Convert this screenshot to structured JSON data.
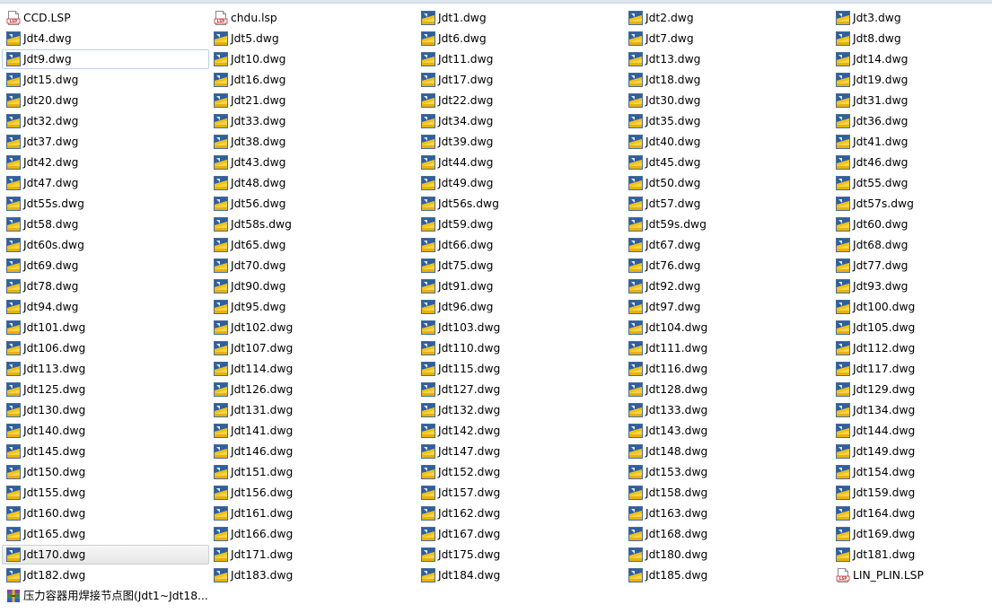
{
  "files": [
    {
      "name": "CCD.LSP",
      "icon": "lsp-file-icon"
    },
    {
      "name": "chdu.lsp",
      "icon": "lsp-file-icon"
    },
    {
      "name": "Jdt1.dwg",
      "icon": "dwg-file-icon"
    },
    {
      "name": "Jdt2.dwg",
      "icon": "dwg-file-icon"
    },
    {
      "name": "Jdt3.dwg",
      "icon": "dwg-file-icon"
    },
    {
      "name": "Jdt4.dwg",
      "icon": "dwg-file-icon"
    },
    {
      "name": "Jdt5.dwg",
      "icon": "dwg-file-icon"
    },
    {
      "name": "Jdt6.dwg",
      "icon": "dwg-file-icon"
    },
    {
      "name": "Jdt7.dwg",
      "icon": "dwg-file-icon"
    },
    {
      "name": "Jdt8.dwg",
      "icon": "dwg-file-icon"
    },
    {
      "name": "Jdt9.dwg",
      "icon": "dwg-file-icon",
      "state": "focused"
    },
    {
      "name": "Jdt10.dwg",
      "icon": "dwg-file-icon"
    },
    {
      "name": "Jdt11.dwg",
      "icon": "dwg-file-icon"
    },
    {
      "name": "Jdt13.dwg",
      "icon": "dwg-file-icon"
    },
    {
      "name": "Jdt14.dwg",
      "icon": "dwg-file-icon"
    },
    {
      "name": "Jdt15.dwg",
      "icon": "dwg-file-icon"
    },
    {
      "name": "Jdt16.dwg",
      "icon": "dwg-file-icon"
    },
    {
      "name": "Jdt17.dwg",
      "icon": "dwg-file-icon"
    },
    {
      "name": "Jdt18.dwg",
      "icon": "dwg-file-icon"
    },
    {
      "name": "Jdt19.dwg",
      "icon": "dwg-file-icon"
    },
    {
      "name": "Jdt20.dwg",
      "icon": "dwg-file-icon"
    },
    {
      "name": "Jdt21.dwg",
      "icon": "dwg-file-icon"
    },
    {
      "name": "Jdt22.dwg",
      "icon": "dwg-file-icon"
    },
    {
      "name": "Jdt30.dwg",
      "icon": "dwg-file-icon"
    },
    {
      "name": "Jdt31.dwg",
      "icon": "dwg-file-icon"
    },
    {
      "name": "Jdt32.dwg",
      "icon": "dwg-file-icon"
    },
    {
      "name": "Jdt33.dwg",
      "icon": "dwg-file-icon"
    },
    {
      "name": "Jdt34.dwg",
      "icon": "dwg-file-icon"
    },
    {
      "name": "Jdt35.dwg",
      "icon": "dwg-file-icon"
    },
    {
      "name": "Jdt36.dwg",
      "icon": "dwg-file-icon"
    },
    {
      "name": "Jdt37.dwg",
      "icon": "dwg-file-icon"
    },
    {
      "name": "Jdt38.dwg",
      "icon": "dwg-file-icon"
    },
    {
      "name": "Jdt39.dwg",
      "icon": "dwg-file-icon"
    },
    {
      "name": "Jdt40.dwg",
      "icon": "dwg-file-icon"
    },
    {
      "name": "Jdt41.dwg",
      "icon": "dwg-file-icon"
    },
    {
      "name": "Jdt42.dwg",
      "icon": "dwg-file-icon"
    },
    {
      "name": "Jdt43.dwg",
      "icon": "dwg-file-icon"
    },
    {
      "name": "Jdt44.dwg",
      "icon": "dwg-file-icon"
    },
    {
      "name": "Jdt45.dwg",
      "icon": "dwg-file-icon"
    },
    {
      "name": "Jdt46.dwg",
      "icon": "dwg-file-icon"
    },
    {
      "name": "Jdt47.dwg",
      "icon": "dwg-file-icon"
    },
    {
      "name": "Jdt48.dwg",
      "icon": "dwg-file-icon"
    },
    {
      "name": "Jdt49.dwg",
      "icon": "dwg-file-icon"
    },
    {
      "name": "Jdt50.dwg",
      "icon": "dwg-file-icon"
    },
    {
      "name": "Jdt55.dwg",
      "icon": "dwg-file-icon"
    },
    {
      "name": "Jdt55s.dwg",
      "icon": "dwg-file-icon"
    },
    {
      "name": "Jdt56.dwg",
      "icon": "dwg-file-icon"
    },
    {
      "name": "Jdt56s.dwg",
      "icon": "dwg-file-icon"
    },
    {
      "name": "Jdt57.dwg",
      "icon": "dwg-file-icon"
    },
    {
      "name": "Jdt57s.dwg",
      "icon": "dwg-file-icon"
    },
    {
      "name": "Jdt58.dwg",
      "icon": "dwg-file-icon"
    },
    {
      "name": "Jdt58s.dwg",
      "icon": "dwg-file-icon"
    },
    {
      "name": "Jdt59.dwg",
      "icon": "dwg-file-icon"
    },
    {
      "name": "Jdt59s.dwg",
      "icon": "dwg-file-icon"
    },
    {
      "name": "Jdt60.dwg",
      "icon": "dwg-file-icon"
    },
    {
      "name": "Jdt60s.dwg",
      "icon": "dwg-file-icon"
    },
    {
      "name": "Jdt65.dwg",
      "icon": "dwg-file-icon"
    },
    {
      "name": "Jdt66.dwg",
      "icon": "dwg-file-icon"
    },
    {
      "name": "Jdt67.dwg",
      "icon": "dwg-file-icon"
    },
    {
      "name": "Jdt68.dwg",
      "icon": "dwg-file-icon"
    },
    {
      "name": "Jdt69.dwg",
      "icon": "dwg-file-icon"
    },
    {
      "name": "Jdt70.dwg",
      "icon": "dwg-file-icon"
    },
    {
      "name": "Jdt75.dwg",
      "icon": "dwg-file-icon"
    },
    {
      "name": "Jdt76.dwg",
      "icon": "dwg-file-icon"
    },
    {
      "name": "Jdt77.dwg",
      "icon": "dwg-file-icon"
    },
    {
      "name": "Jdt78.dwg",
      "icon": "dwg-file-icon"
    },
    {
      "name": "Jdt90.dwg",
      "icon": "dwg-file-icon"
    },
    {
      "name": "Jdt91.dwg",
      "icon": "dwg-file-icon"
    },
    {
      "name": "Jdt92.dwg",
      "icon": "dwg-file-icon"
    },
    {
      "name": "Jdt93.dwg",
      "icon": "dwg-file-icon"
    },
    {
      "name": "Jdt94.dwg",
      "icon": "dwg-file-icon"
    },
    {
      "name": "Jdt95.dwg",
      "icon": "dwg-file-icon"
    },
    {
      "name": "Jdt96.dwg",
      "icon": "dwg-file-icon"
    },
    {
      "name": "Jdt97.dwg",
      "icon": "dwg-file-icon"
    },
    {
      "name": "Jdt100.dwg",
      "icon": "dwg-file-icon"
    },
    {
      "name": "Jdt101.dwg",
      "icon": "dwg-file-icon"
    },
    {
      "name": "Jdt102.dwg",
      "icon": "dwg-file-icon"
    },
    {
      "name": "Jdt103.dwg",
      "icon": "dwg-file-icon"
    },
    {
      "name": "Jdt104.dwg",
      "icon": "dwg-file-icon"
    },
    {
      "name": "Jdt105.dwg",
      "icon": "dwg-file-icon"
    },
    {
      "name": "Jdt106.dwg",
      "icon": "dwg-file-icon"
    },
    {
      "name": "Jdt107.dwg",
      "icon": "dwg-file-icon"
    },
    {
      "name": "Jdt110.dwg",
      "icon": "dwg-file-icon"
    },
    {
      "name": "Jdt111.dwg",
      "icon": "dwg-file-icon"
    },
    {
      "name": "Jdt112.dwg",
      "icon": "dwg-file-icon"
    },
    {
      "name": "Jdt113.dwg",
      "icon": "dwg-file-icon"
    },
    {
      "name": "Jdt114.dwg",
      "icon": "dwg-file-icon"
    },
    {
      "name": "Jdt115.dwg",
      "icon": "dwg-file-icon"
    },
    {
      "name": "Jdt116.dwg",
      "icon": "dwg-file-icon"
    },
    {
      "name": "Jdt117.dwg",
      "icon": "dwg-file-icon"
    },
    {
      "name": "Jdt125.dwg",
      "icon": "dwg-file-icon"
    },
    {
      "name": "Jdt126.dwg",
      "icon": "dwg-file-icon"
    },
    {
      "name": "Jdt127.dwg",
      "icon": "dwg-file-icon"
    },
    {
      "name": "Jdt128.dwg",
      "icon": "dwg-file-icon"
    },
    {
      "name": "Jdt129.dwg",
      "icon": "dwg-file-icon"
    },
    {
      "name": "Jdt130.dwg",
      "icon": "dwg-file-icon"
    },
    {
      "name": "Jdt131.dwg",
      "icon": "dwg-file-icon"
    },
    {
      "name": "Jdt132.dwg",
      "icon": "dwg-file-icon"
    },
    {
      "name": "Jdt133.dwg",
      "icon": "dwg-file-icon"
    },
    {
      "name": "Jdt134.dwg",
      "icon": "dwg-file-icon"
    },
    {
      "name": "Jdt140.dwg",
      "icon": "dwg-file-icon"
    },
    {
      "name": "Jdt141.dwg",
      "icon": "dwg-file-icon"
    },
    {
      "name": "Jdt142.dwg",
      "icon": "dwg-file-icon"
    },
    {
      "name": "Jdt143.dwg",
      "icon": "dwg-file-icon"
    },
    {
      "name": "Jdt144.dwg",
      "icon": "dwg-file-icon"
    },
    {
      "name": "Jdt145.dwg",
      "icon": "dwg-file-icon"
    },
    {
      "name": "Jdt146.dwg",
      "icon": "dwg-file-icon"
    },
    {
      "name": "Jdt147.dwg",
      "icon": "dwg-file-icon"
    },
    {
      "name": "Jdt148.dwg",
      "icon": "dwg-file-icon"
    },
    {
      "name": "Jdt149.dwg",
      "icon": "dwg-file-icon"
    },
    {
      "name": "Jdt150.dwg",
      "icon": "dwg-file-icon"
    },
    {
      "name": "Jdt151.dwg",
      "icon": "dwg-file-icon"
    },
    {
      "name": "Jdt152.dwg",
      "icon": "dwg-file-icon"
    },
    {
      "name": "Jdt153.dwg",
      "icon": "dwg-file-icon"
    },
    {
      "name": "Jdt154.dwg",
      "icon": "dwg-file-icon"
    },
    {
      "name": "Jdt155.dwg",
      "icon": "dwg-file-icon"
    },
    {
      "name": "Jdt156.dwg",
      "icon": "dwg-file-icon"
    },
    {
      "name": "Jdt157.dwg",
      "icon": "dwg-file-icon"
    },
    {
      "name": "Jdt158.dwg",
      "icon": "dwg-file-icon"
    },
    {
      "name": "Jdt159.dwg",
      "icon": "dwg-file-icon"
    },
    {
      "name": "Jdt160.dwg",
      "icon": "dwg-file-icon"
    },
    {
      "name": "Jdt161.dwg",
      "icon": "dwg-file-icon"
    },
    {
      "name": "Jdt162.dwg",
      "icon": "dwg-file-icon"
    },
    {
      "name": "Jdt163.dwg",
      "icon": "dwg-file-icon"
    },
    {
      "name": "Jdt164.dwg",
      "icon": "dwg-file-icon"
    },
    {
      "name": "Jdt165.dwg",
      "icon": "dwg-file-icon"
    },
    {
      "name": "Jdt166.dwg",
      "icon": "dwg-file-icon"
    },
    {
      "name": "Jdt167.dwg",
      "icon": "dwg-file-icon"
    },
    {
      "name": "Jdt168.dwg",
      "icon": "dwg-file-icon"
    },
    {
      "name": "Jdt169.dwg",
      "icon": "dwg-file-icon"
    },
    {
      "name": "Jdt170.dwg",
      "icon": "dwg-file-icon",
      "state": "hovered"
    },
    {
      "name": "Jdt171.dwg",
      "icon": "dwg-file-icon"
    },
    {
      "name": "Jdt175.dwg",
      "icon": "dwg-file-icon"
    },
    {
      "name": "Jdt180.dwg",
      "icon": "dwg-file-icon"
    },
    {
      "name": "Jdt181.dwg",
      "icon": "dwg-file-icon"
    },
    {
      "name": "Jdt182.dwg",
      "icon": "dwg-file-icon"
    },
    {
      "name": "Jdt183.dwg",
      "icon": "dwg-file-icon"
    },
    {
      "name": "Jdt184.dwg",
      "icon": "dwg-file-icon"
    },
    {
      "name": "Jdt185.dwg",
      "icon": "dwg-file-icon"
    },
    {
      "name": "LIN_PLIN.LSP",
      "icon": "lsp-file-icon"
    },
    {
      "name": "压力容器用焊接节点图(Jdt1~Jdt18...",
      "icon": "archive-file-icon"
    }
  ],
  "colors": {
    "focus_border": "#b9d2ea",
    "hover_border": "#cfcfcf",
    "dwg_yellow": "#f2c21b",
    "dwg_blue": "#2f5f9e"
  }
}
